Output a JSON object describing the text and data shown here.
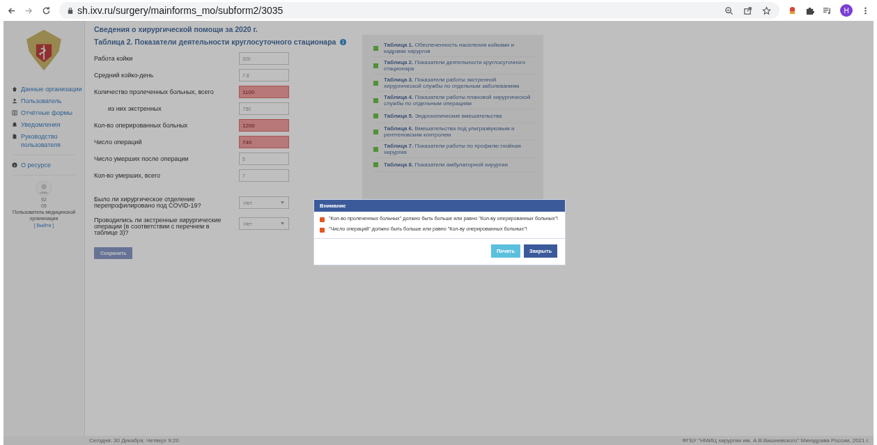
{
  "browser": {
    "url": "sh.ixv.ru/surgery/mainforms_mo/subform2/3035",
    "profile": "H"
  },
  "sidebar": {
    "items": [
      {
        "label": "Данные организации"
      },
      {
        "label": "Пользователь"
      },
      {
        "label": "Отчётные формы"
      },
      {
        "label": "Уведомления"
      },
      {
        "label": "Руководство пользователя"
      }
    ],
    "about": "О ресурсе",
    "user_lines": [
      "92",
      "05"
    ],
    "user_role": "Пользователь медицинской организации",
    "logout": "[ Выйти ]"
  },
  "page": {
    "title": "Сведения о хирургической помощи за 2020 г.",
    "subtitle": "Таблица 2. Показатели деятельности круглосуточного стационара"
  },
  "form": {
    "fields": [
      {
        "kind": "input",
        "label": "Работа койки",
        "value": "320",
        "error": false
      },
      {
        "kind": "input",
        "label": "Средний койко-день",
        "value": "7.8",
        "error": false
      },
      {
        "kind": "input",
        "label": "Количество пролеченных больных, всего",
        "value": "1100",
        "error": true
      },
      {
        "kind": "subinput",
        "label": "из них экстренных",
        "value": "750",
        "error": false
      },
      {
        "kind": "input",
        "label": "Кол-во оперированных больных",
        "value": "1200",
        "error": true
      },
      {
        "kind": "input",
        "label": "Число операций",
        "value": "740",
        "error": true
      },
      {
        "kind": "input",
        "label": "Число умерших после операции",
        "value": "5",
        "error": false
      },
      {
        "kind": "input",
        "label": "Кол-во умерших, всего",
        "value": "7",
        "error": false
      },
      {
        "kind": "select",
        "label": "Было ли хирургическое отделение перепрофилировано под COVID-19?",
        "value": "Нет"
      },
      {
        "kind": "select",
        "label": "Проводились ли экстренные хирургические операции (в соответствии с перечнем в таблице 3)?",
        "value": "Нет"
      }
    ],
    "save": "Сохранить"
  },
  "tables": [
    {
      "number": "Таблица 1.",
      "title": "Обеспеченность населения койками и кадрами хирургов"
    },
    {
      "number": "Таблица 2.",
      "title": "Показатели деятельности круглосуточного стационара"
    },
    {
      "number": "Таблица 3.",
      "title": "Показатели работы экстренной хирургической службы по отдельным заболеваниям"
    },
    {
      "number": "Таблица 4.",
      "title": "Показатели работы плановой хирургической службы по отдельным операциям"
    },
    {
      "number": "Таблица 5.",
      "title": "Эндоскопические вмешательства"
    },
    {
      "number": "Таблица 6.",
      "title": "Вмешательства под ультразвуковым и рентгеновским контролем"
    },
    {
      "number": "Таблица 7.",
      "title": "Показатели работы по профилю гнойная хирургия"
    },
    {
      "number": "Таблица 8.",
      "title": "Показатели амбулаторной хирургии"
    }
  ],
  "footer": {
    "left": "Сегодня: 30 Декабря, Четверг 9:20",
    "right": "ФГБУ \"НМИЦ хирургии им. А.В.Вишневского\" Минздрава России, 2021 г."
  },
  "dialog": {
    "title": "Внимание",
    "messages": [
      "\"Кол-во пролеченных больных\" должно быть больше или равно \"Кол-ву оперированных больных\"!",
      "\"Число операций\" должно быть больше или равно \"Кол-ву оперированных больных\"!"
    ],
    "buttons": [
      {
        "label": "Печать",
        "kind": "secondary"
      },
      {
        "label": "Закрыть",
        "kind": "primary"
      }
    ]
  }
}
